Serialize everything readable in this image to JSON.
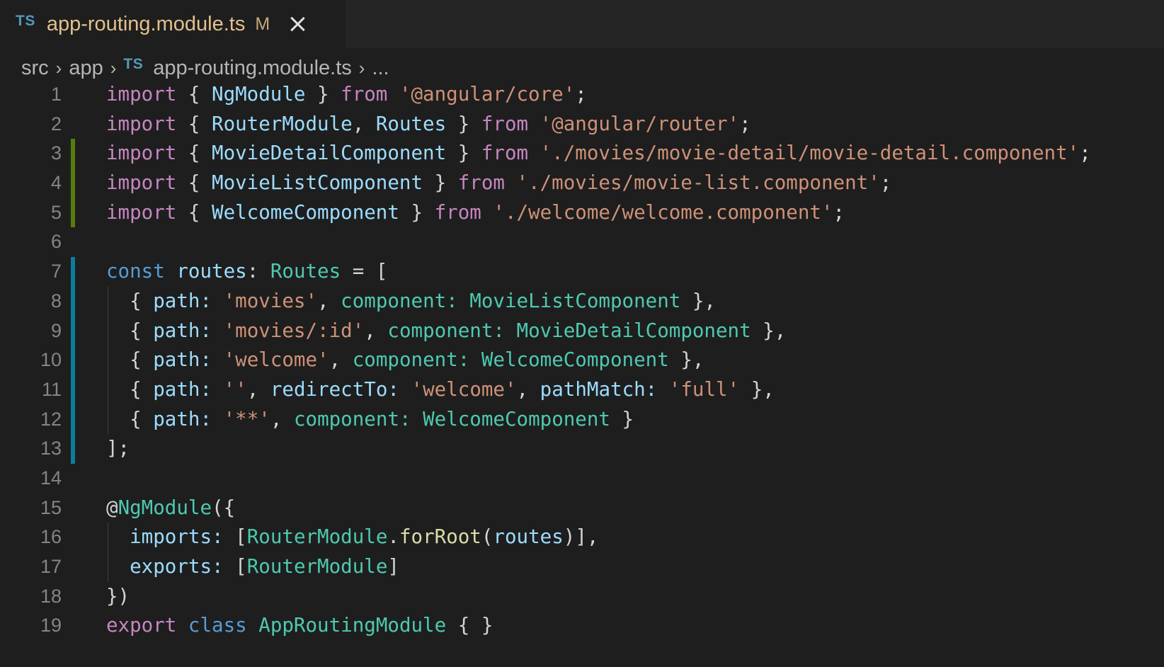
{
  "tab": {
    "lang_badge": "TS",
    "title": "app-routing.module.ts",
    "status": "M"
  },
  "breadcrumb": {
    "items": [
      "src",
      "app",
      "app-routing.module.ts",
      "..."
    ],
    "lang_badge": "TS"
  },
  "colors": {
    "added_gutter": "#587c0c",
    "modified_gutter": "#0c7d9d",
    "keyword": "#c586c0",
    "storage": "#569cd6",
    "string": "#ce9178",
    "type": "#4ec9b0",
    "variable": "#9cdcfe",
    "function": "#dcdcaa"
  },
  "code": {
    "lines": [
      {
        "num": "1",
        "gutter": "",
        "indent": false,
        "tokens": [
          {
            "t": "import",
            "c": "kw"
          },
          {
            "t": " { ",
            "c": "punc"
          },
          {
            "t": "NgModule",
            "c": "var"
          },
          {
            "t": " } ",
            "c": "punc"
          },
          {
            "t": "from",
            "c": "kw"
          },
          {
            "t": " ",
            "c": "punc"
          },
          {
            "t": "'@angular/core'",
            "c": "str"
          },
          {
            "t": ";",
            "c": "punc"
          }
        ]
      },
      {
        "num": "2",
        "gutter": "",
        "indent": false,
        "tokens": [
          {
            "t": "import",
            "c": "kw"
          },
          {
            "t": " { ",
            "c": "punc"
          },
          {
            "t": "RouterModule",
            "c": "var"
          },
          {
            "t": ", ",
            "c": "punc"
          },
          {
            "t": "Routes",
            "c": "var"
          },
          {
            "t": " } ",
            "c": "punc"
          },
          {
            "t": "from",
            "c": "kw"
          },
          {
            "t": " ",
            "c": "punc"
          },
          {
            "t": "'@angular/router'",
            "c": "str"
          },
          {
            "t": ";",
            "c": "punc"
          }
        ]
      },
      {
        "num": "3",
        "gutter": "added",
        "indent": false,
        "tokens": [
          {
            "t": "import",
            "c": "kw"
          },
          {
            "t": " { ",
            "c": "punc"
          },
          {
            "t": "MovieDetailComponent",
            "c": "var"
          },
          {
            "t": " } ",
            "c": "punc"
          },
          {
            "t": "from",
            "c": "kw"
          },
          {
            "t": " ",
            "c": "punc"
          },
          {
            "t": "'./movies/movie-detail/movie-detail.component'",
            "c": "str"
          },
          {
            "t": ";",
            "c": "punc"
          }
        ]
      },
      {
        "num": "4",
        "gutter": "added",
        "indent": false,
        "tokens": [
          {
            "t": "import",
            "c": "kw"
          },
          {
            "t": " { ",
            "c": "punc"
          },
          {
            "t": "MovieListComponent",
            "c": "var"
          },
          {
            "t": " } ",
            "c": "punc"
          },
          {
            "t": "from",
            "c": "kw"
          },
          {
            "t": " ",
            "c": "punc"
          },
          {
            "t": "'./movies/movie-list.component'",
            "c": "str"
          },
          {
            "t": ";",
            "c": "punc"
          }
        ]
      },
      {
        "num": "5",
        "gutter": "added",
        "indent": false,
        "tokens": [
          {
            "t": "import",
            "c": "kw"
          },
          {
            "t": " { ",
            "c": "punc"
          },
          {
            "t": "WelcomeComponent",
            "c": "var"
          },
          {
            "t": " } ",
            "c": "punc"
          },
          {
            "t": "from",
            "c": "kw"
          },
          {
            "t": " ",
            "c": "punc"
          },
          {
            "t": "'./welcome/welcome.component'",
            "c": "str"
          },
          {
            "t": ";",
            "c": "punc"
          }
        ]
      },
      {
        "num": "6",
        "gutter": "",
        "indent": false,
        "tokens": []
      },
      {
        "num": "7",
        "gutter": "modified",
        "indent": false,
        "tokens": [
          {
            "t": "const",
            "c": "kwb"
          },
          {
            "t": " ",
            "c": "punc"
          },
          {
            "t": "routes",
            "c": "var"
          },
          {
            "t": ": ",
            "c": "punc"
          },
          {
            "t": "Routes",
            "c": "type"
          },
          {
            "t": " = [",
            "c": "punc"
          }
        ]
      },
      {
        "num": "8",
        "gutter": "modified",
        "indent": true,
        "tokens": [
          {
            "t": "  { ",
            "c": "punc"
          },
          {
            "t": "path",
            "c": "var"
          },
          {
            "t": ": ",
            "c": "var"
          },
          {
            "t": "'movies'",
            "c": "str"
          },
          {
            "t": ", ",
            "c": "punc"
          },
          {
            "t": "component: ",
            "c": "type"
          },
          {
            "t": "MovieListComponent",
            "c": "type"
          },
          {
            "t": " },",
            "c": "punc"
          }
        ]
      },
      {
        "num": "9",
        "gutter": "modified",
        "indent": true,
        "tokens": [
          {
            "t": "  { ",
            "c": "punc"
          },
          {
            "t": "path",
            "c": "var"
          },
          {
            "t": ": ",
            "c": "var"
          },
          {
            "t": "'movies/:id'",
            "c": "str"
          },
          {
            "t": ", ",
            "c": "punc"
          },
          {
            "t": "component: ",
            "c": "type"
          },
          {
            "t": "MovieDetailComponent",
            "c": "type"
          },
          {
            "t": " },",
            "c": "punc"
          }
        ]
      },
      {
        "num": "10",
        "gutter": "modified",
        "indent": true,
        "tokens": [
          {
            "t": "  { ",
            "c": "punc"
          },
          {
            "t": "path",
            "c": "var"
          },
          {
            "t": ": ",
            "c": "var"
          },
          {
            "t": "'welcome'",
            "c": "str"
          },
          {
            "t": ", ",
            "c": "punc"
          },
          {
            "t": "component: ",
            "c": "type"
          },
          {
            "t": "WelcomeComponent",
            "c": "type"
          },
          {
            "t": " },",
            "c": "punc"
          }
        ]
      },
      {
        "num": "11",
        "gutter": "modified",
        "indent": true,
        "tokens": [
          {
            "t": "  { ",
            "c": "punc"
          },
          {
            "t": "path",
            "c": "var"
          },
          {
            "t": ": ",
            "c": "var"
          },
          {
            "t": "''",
            "c": "str"
          },
          {
            "t": ", ",
            "c": "punc"
          },
          {
            "t": "redirectTo: ",
            "c": "var"
          },
          {
            "t": "'welcome'",
            "c": "str"
          },
          {
            "t": ", ",
            "c": "punc"
          },
          {
            "t": "pathMatch: ",
            "c": "var"
          },
          {
            "t": "'full'",
            "c": "str"
          },
          {
            "t": " },",
            "c": "punc"
          }
        ]
      },
      {
        "num": "12",
        "gutter": "modified",
        "indent": true,
        "tokens": [
          {
            "t": "  { ",
            "c": "punc"
          },
          {
            "t": "path",
            "c": "var"
          },
          {
            "t": ": ",
            "c": "var"
          },
          {
            "t": "'**'",
            "c": "str"
          },
          {
            "t": ", ",
            "c": "punc"
          },
          {
            "t": "component: ",
            "c": "type"
          },
          {
            "t": "WelcomeComponent",
            "c": "type"
          },
          {
            "t": " }",
            "c": "punc"
          }
        ]
      },
      {
        "num": "13",
        "gutter": "modified",
        "indent": false,
        "tokens": [
          {
            "t": "];",
            "c": "punc"
          }
        ]
      },
      {
        "num": "14",
        "gutter": "",
        "indent": false,
        "tokens": []
      },
      {
        "num": "15",
        "gutter": "",
        "indent": false,
        "tokens": [
          {
            "t": "@",
            "c": "punc"
          },
          {
            "t": "NgModule",
            "c": "type"
          },
          {
            "t": "({",
            "c": "punc"
          }
        ]
      },
      {
        "num": "16",
        "gutter": "",
        "indent": true,
        "tokens": [
          {
            "t": "  ",
            "c": "punc"
          },
          {
            "t": "imports",
            "c": "var"
          },
          {
            "t": ": ",
            "c": "var"
          },
          {
            "t": "[",
            "c": "punc"
          },
          {
            "t": "RouterModule",
            "c": "type"
          },
          {
            "t": ".",
            "c": "punc"
          },
          {
            "t": "forRoot",
            "c": "fn"
          },
          {
            "t": "(",
            "c": "punc"
          },
          {
            "t": "routes",
            "c": "var"
          },
          {
            "t": ")],",
            "c": "punc"
          }
        ]
      },
      {
        "num": "17",
        "gutter": "",
        "indent": true,
        "tokens": [
          {
            "t": "  ",
            "c": "punc"
          },
          {
            "t": "exports",
            "c": "var"
          },
          {
            "t": ": ",
            "c": "var"
          },
          {
            "t": "[",
            "c": "punc"
          },
          {
            "t": "RouterModule",
            "c": "type"
          },
          {
            "t": "]",
            "c": "punc"
          }
        ]
      },
      {
        "num": "18",
        "gutter": "",
        "indent": false,
        "tokens": [
          {
            "t": "})",
            "c": "punc"
          }
        ]
      },
      {
        "num": "19",
        "gutter": "",
        "indent": false,
        "tokens": [
          {
            "t": "export",
            "c": "kw"
          },
          {
            "t": " ",
            "c": "punc"
          },
          {
            "t": "class",
            "c": "kwb"
          },
          {
            "t": " ",
            "c": "punc"
          },
          {
            "t": "AppRoutingModule",
            "c": "type"
          },
          {
            "t": " { }",
            "c": "punc"
          }
        ]
      }
    ]
  }
}
